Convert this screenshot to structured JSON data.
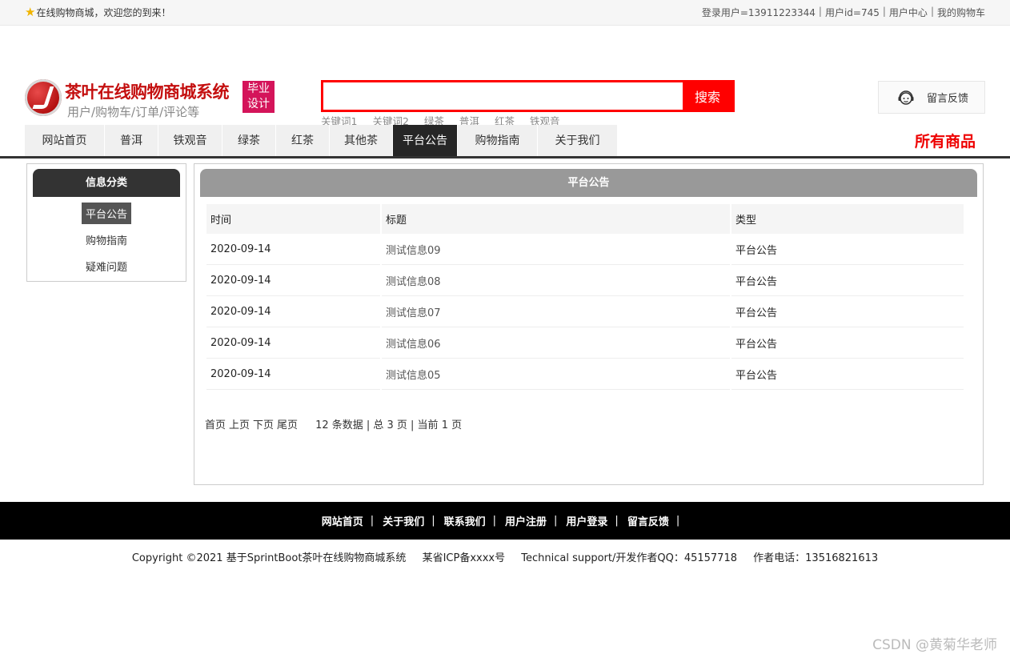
{
  "topbar": {
    "welcome": "在线购物商城，欢迎您的到来！",
    "links": [
      "登录用户=13911223344",
      "用户id=745",
      "用户中心",
      "我的购物车"
    ]
  },
  "header": {
    "title": "茶叶在线购物商城系统",
    "subtitle": "用户/购物车/订单/评论等",
    "badge_line1": "毕业",
    "badge_line2": "设计",
    "search_value": "",
    "search_button": "搜索",
    "keywords": [
      "关键词1",
      "关键词2",
      "绿茶",
      "普洱",
      "红茶",
      "铁观音"
    ],
    "feedback": "留言反馈"
  },
  "nav": {
    "items": [
      "网站首页",
      "普洱",
      "铁观音",
      "绿茶",
      "红茶",
      "其他茶",
      "平台公告",
      "购物指南",
      "关于我们"
    ],
    "active_index": 6,
    "all_products": "所有商品"
  },
  "sidebar": {
    "title": "信息分类",
    "items": [
      "平台公告",
      "购物指南",
      "疑难问题"
    ],
    "active_index": 0
  },
  "main": {
    "title": "平台公告",
    "columns": [
      "时间",
      "标题",
      "类型"
    ],
    "rows": [
      [
        "2020-09-14",
        "测试信息09",
        "平台公告"
      ],
      [
        "2020-09-14",
        "测试信息08",
        "平台公告"
      ],
      [
        "2020-09-14",
        "测试信息07",
        "平台公告"
      ],
      [
        "2020-09-14",
        "测试信息06",
        "平台公告"
      ],
      [
        "2020-09-14",
        "测试信息05",
        "平台公告"
      ]
    ],
    "pager_links": [
      "首页",
      "上页",
      "下页",
      "尾页"
    ],
    "pager_info": "12 条数据 | 总 3 页 | 当前 1 页"
  },
  "footer": {
    "links": [
      "网站首页",
      "关于我们",
      "联系我们",
      "用户注册",
      "用户登录",
      "留言反馈"
    ],
    "copyright": [
      "Copyright ©2021 基于SprintBoot茶叶在线购物商城系统",
      "某省ICP备xxxx号",
      "Technical support/开发作者QQ：45157718",
      "作者电话：13516821613"
    ],
    "watermark": "CSDN @黄菊华老师"
  },
  "colors": {
    "accent": "#ff0000",
    "brand": "#c40f0f",
    "badge": "#d4145a",
    "nav_active": "#262626"
  }
}
